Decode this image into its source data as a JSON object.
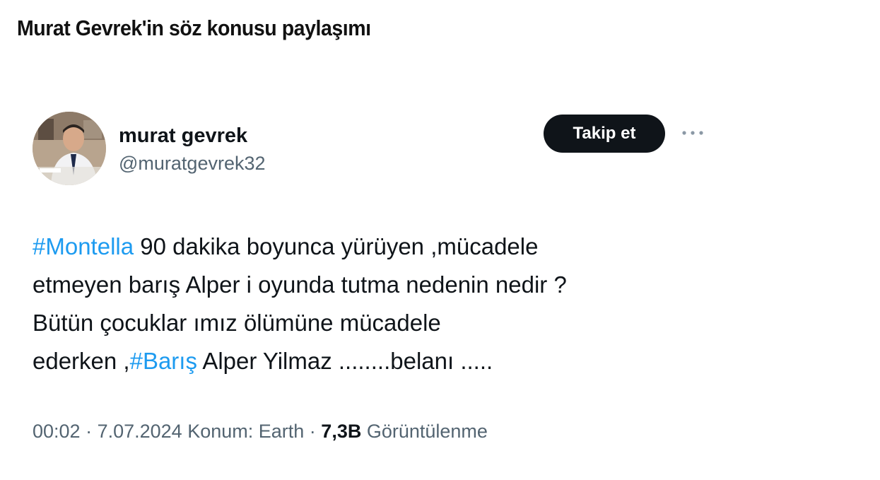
{
  "page": {
    "title": "Murat Gevrek'in söz konusu paylaşımı"
  },
  "tweet": {
    "author": {
      "display_name": "murat gevrek",
      "handle": "@muratgevrek32"
    },
    "follow_button_label": "Takip et",
    "more_icon": "more-horizontal-icon",
    "text": {
      "line1_hashtag": "#Montella",
      "line1_rest": " 90 dakika boyunca yürüyen ,mücadele",
      "line2": "etmeyen barış Alper i oyunda tutma nedenin nedir ?",
      "line3": "Bütün çocuklar ımız ölümüne mücadele",
      "line4_start": "ederken ,",
      "line4_hashtag": "#Barış",
      "line4_rest": " Alper Yilmaz ........belanı ....."
    },
    "meta": {
      "time": "00:02",
      "separator1": " · ",
      "date": "7.07.2024",
      "location": " Konum: Earth",
      "separator2": " · ",
      "views_count": "7,3B",
      "views_label": " Görüntülenme"
    }
  },
  "colors": {
    "text": "#0f1419",
    "secondary": "#536471",
    "hashtag": "#1d9bf0",
    "follow_bg": "#0f1419"
  }
}
